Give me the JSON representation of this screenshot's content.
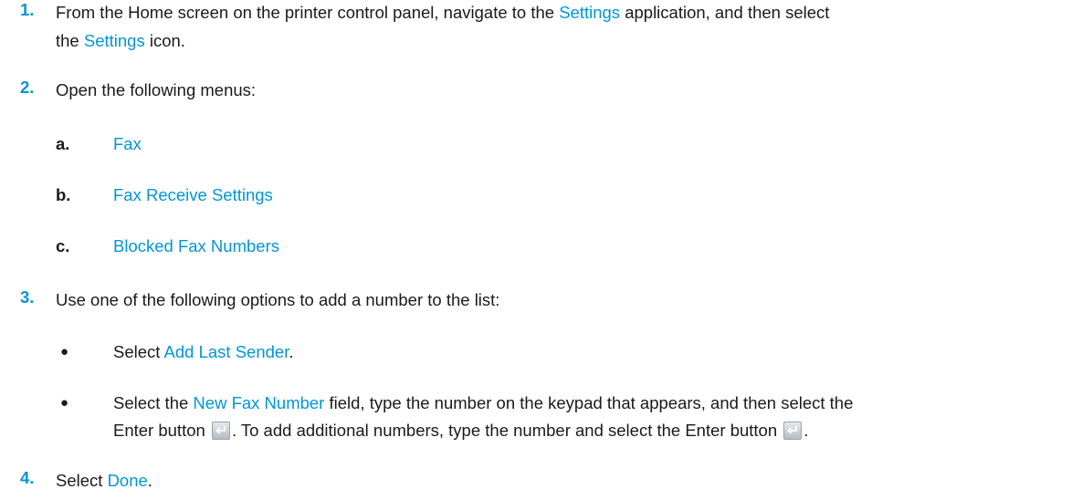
{
  "steps": [
    {
      "num": "1.",
      "pre": "From the Home screen on the printer control panel, navigate to the ",
      "link1": "Settings",
      "mid": " application, and then select",
      "line2_pre": "the ",
      "link2": "Settings",
      "post": " icon."
    },
    {
      "num": "2.",
      "text": "Open the following menus:",
      "subs": [
        {
          "letter": "a.",
          "label": "Fax"
        },
        {
          "letter": "b.",
          "label": "Fax Receive Settings"
        },
        {
          "letter": "c.",
          "label": "Blocked Fax Numbers"
        }
      ]
    },
    {
      "num": "3.",
      "text": "Use one of the following options to add a number to the list:",
      "bullet1_pre": "Select ",
      "bullet1_link": "Add Last Sender",
      "bullet1_post": ".",
      "bullet2_pre": "Select the ",
      "bullet2_link": "New Fax Number",
      "bullet2_mid": " field, type the number on the keypad that appears, and then select the",
      "bullet2_line2_pre": "Enter button ",
      "bullet2_line2_mid": ". To add additional numbers, type the number and select the Enter button ",
      "bullet2_line2_post": "."
    },
    {
      "num": "4.",
      "pre": "Select ",
      "link": "Done",
      "post": "."
    }
  ],
  "icons": {
    "enter": "enter-key-icon",
    "bullet": "●"
  },
  "colors": {
    "accent": "#0096d6",
    "text": "#1a1a1a"
  }
}
